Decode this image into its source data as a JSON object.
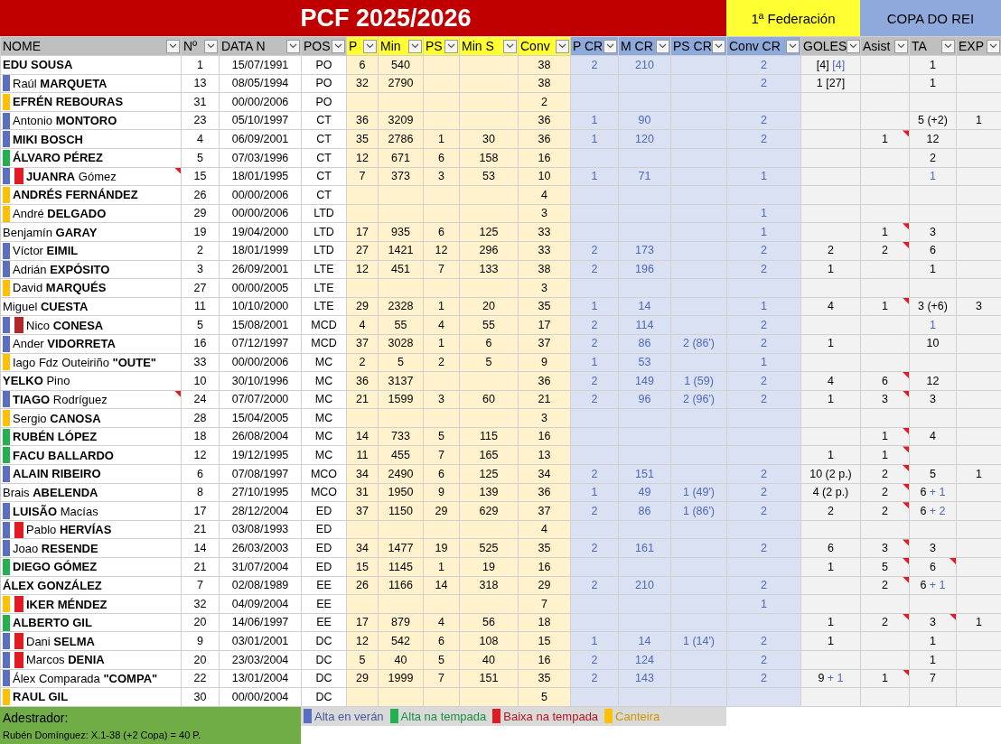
{
  "bands": [
    {
      "label": "PCF 2025/2026",
      "kind": "title"
    },
    {
      "label": "1ª Federación",
      "kind": "league"
    },
    {
      "label": "COPA DO REI",
      "kind": "cup"
    }
  ],
  "columns": [
    {
      "label": "NOME",
      "kind": "info"
    },
    {
      "label": "Nº",
      "kind": "info"
    },
    {
      "label": "DATA N",
      "kind": "info"
    },
    {
      "label": "POS",
      "kind": "info"
    },
    {
      "label": "P",
      "kind": "league"
    },
    {
      "label": "Min",
      "kind": "league"
    },
    {
      "label": "PS",
      "kind": "league"
    },
    {
      "label": "Min S",
      "kind": "league"
    },
    {
      "label": "Conv",
      "kind": "league"
    },
    {
      "label": "P CR",
      "kind": "cup"
    },
    {
      "label": "M CR",
      "kind": "cup"
    },
    {
      "label": "PS CR",
      "kind": "cup"
    },
    {
      "label": "Conv CR",
      "kind": "cup"
    },
    {
      "label": "GOLES",
      "kind": "stats"
    },
    {
      "label": "Asist",
      "kind": "stats"
    },
    {
      "label": "TA",
      "kind": "stats"
    },
    {
      "label": "EXP",
      "kind": "stats"
    }
  ],
  "rows": [
    {
      "name": "EDU SOUSA",
      "bold": true,
      "comment": false,
      "cells": [
        "1",
        "15/07/1991",
        "PO",
        "6",
        "540",
        null,
        null,
        "38",
        "2",
        "210",
        null,
        "2",
        {
          "parts": [
            {
              "text": "[4]",
              "accent": false
            },
            {
              "text": "[4]",
              "accent": true
            }
          ]
        },
        null,
        "1",
        null
      ]
    },
    {
      "name": "Raúl **MARQUETA**",
      "bold": false,
      "comment": false,
      "markers": [
        {
          "color": "#5a6ec4"
        }
      ],
      "cells": [
        "13",
        "08/05/1994",
        "PO",
        "32",
        "2790",
        null,
        null,
        "38",
        null,
        null,
        null,
        "2",
        "1 [27]",
        null,
        "1",
        null
      ]
    },
    {
      "name": "EFRÉN REBOURAS",
      "bold": true,
      "comment": false,
      "markers": [
        {
          "color": "#ffc000"
        }
      ],
      "cells": [
        "31",
        "00/00/2006",
        "PO",
        null,
        null,
        null,
        null,
        "2",
        null,
        null,
        null,
        null,
        null,
        null,
        null,
        null
      ]
    },
    {
      "name": "Antonio **MONTORO**",
      "bold": false,
      "comment": false,
      "markers": [
        {
          "color": "#5a6ec4"
        }
      ],
      "cells": [
        "23",
        "05/10/1997",
        "CT",
        "36",
        "3209",
        null,
        null,
        "36",
        "1",
        "90",
        null,
        "2",
        null,
        null,
        "5 (+2)",
        "1"
      ]
    },
    {
      "name": "MIKI BOSCH",
      "bold": true,
      "comment": false,
      "markers": [
        {
          "color": "#5a6ec4"
        }
      ],
      "cells": [
        "4",
        "06/09/2001",
        "CT",
        "35",
        "2786",
        "1",
        "30",
        "36",
        "1",
        "120",
        null,
        "2",
        null,
        {
          "text": "1",
          "comment": true
        },
        "12",
        null
      ]
    },
    {
      "name": "ÁLVARO PÉREZ",
      "bold": true,
      "comment": false,
      "markers": [
        {
          "color": "#22b14c"
        }
      ],
      "cells": [
        "5",
        "07/03/1996",
        "CT",
        "12",
        "671",
        "6",
        "158",
        "16",
        null,
        null,
        null,
        null,
        null,
        null,
        "2",
        null
      ]
    },
    {
      "name": "**JUANRA** Gómez",
      "bold": false,
      "comment": true,
      "markers": [
        {
          "color": "#5a6ec4"
        },
        {
          "color": "#e01b24"
        }
      ],
      "cells": [
        "15",
        "18/01/1995",
        "CT",
        "7",
        "373",
        "3",
        "53",
        "10",
        "1",
        "71",
        null,
        "1",
        null,
        null,
        {
          "parts": [
            {
              "text": "1",
              "accent": true
            }
          ]
        },
        null
      ]
    },
    {
      "name": "ANDRÉS FERNÁNDEZ",
      "bold": true,
      "comment": false,
      "markers": [
        {
          "color": "#ffc000"
        }
      ],
      "cells": [
        "26",
        "00/00/2006",
        "CT",
        null,
        null,
        null,
        null,
        "4",
        null,
        null,
        null,
        null,
        null,
        null,
        null,
        null
      ]
    },
    {
      "name": "André **DELGADO**",
      "bold": false,
      "comment": false,
      "markers": [
        {
          "color": "#ffc000"
        }
      ],
      "cells": [
        "29",
        "00/00/2006",
        "LTD",
        null,
        null,
        null,
        null,
        "3",
        null,
        null,
        null,
        "1",
        null,
        null,
        null,
        null
      ]
    },
    {
      "name": "Benjamín **GARAY**",
      "bold": false,
      "comment": false,
      "cells": [
        "19",
        "19/04/2000",
        "LTD",
        "17",
        "935",
        "6",
        "125",
        "33",
        null,
        null,
        null,
        "1",
        null,
        {
          "text": "1",
          "comment": true
        },
        "3",
        null
      ]
    },
    {
      "name": "Víctor **EIMIL**",
      "bold": false,
      "comment": false,
      "markers": [
        {
          "color": "#5a6ec4"
        }
      ],
      "cells": [
        "2",
        "18/01/1999",
        "LTD",
        "27",
        "1421",
        "12",
        "296",
        "33",
        "2",
        "173",
        null,
        "2",
        "2",
        {
          "text": "2",
          "comment": true
        },
        "6",
        null
      ]
    },
    {
      "name": "Adrián **EXPÓSITO**",
      "bold": false,
      "comment": false,
      "markers": [
        {
          "color": "#5a6ec4"
        }
      ],
      "cells": [
        "3",
        "26/09/2001",
        "LTE",
        "12",
        "451",
        "7",
        "133",
        "38",
        "2",
        "196",
        null,
        "2",
        "1",
        null,
        "1",
        null
      ]
    },
    {
      "name": "David **MARQUÉS**",
      "bold": false,
      "comment": false,
      "markers": [
        {
          "color": "#ffc000"
        }
      ],
      "cells": [
        "27",
        "00/00/2005",
        "LTE",
        null,
        null,
        null,
        null,
        "3",
        null,
        null,
        null,
        null,
        null,
        null,
        null,
        null
      ]
    },
    {
      "name": "Miguel **CUESTA**",
      "bold": false,
      "comment": false,
      "cells": [
        "11",
        "10/10/2000",
        "LTE",
        "29",
        "2328",
        "1",
        "20",
        "35",
        "1",
        "14",
        null,
        "1",
        "4",
        {
          "text": "1",
          "comment": true
        },
        "3 (+6)",
        "3"
      ]
    },
    {
      "name": "Nico **CONESA**",
      "bold": false,
      "comment": false,
      "markers": [
        {
          "color": "#5a6ec4"
        },
        {
          "color": "#b0262a"
        }
      ],
      "cells": [
        "5",
        "15/08/2001",
        "MCD",
        "4",
        "55",
        "4",
        "55",
        "17",
        "2",
        "114",
        null,
        "2",
        null,
        null,
        {
          "parts": [
            {
              "text": "1",
              "accent": true
            }
          ]
        },
        null
      ]
    },
    {
      "name": "Ander **VIDORRETA**",
      "bold": false,
      "comment": false,
      "markers": [
        {
          "color": "#5a6ec4"
        }
      ],
      "cells": [
        "16",
        "07/12/1997",
        "MCD",
        "37",
        "3028",
        "1",
        "6",
        "37",
        "2",
        "86",
        "2 (86')",
        "2",
        "1",
        null,
        "10",
        null
      ]
    },
    {
      "name": "Iago Fdz Outeiriño **\"OUTE\"**",
      "bold": false,
      "comment": false,
      "markers": [
        {
          "color": "#ffc000"
        }
      ],
      "cells": [
        "33",
        "00/00/2006",
        "MC",
        "2",
        "5",
        "2",
        "5",
        "9",
        "1",
        "53",
        null,
        "1",
        null,
        null,
        null,
        null
      ]
    },
    {
      "name": "**YELKO** Pino",
      "bold": false,
      "comment": false,
      "cells": [
        "10",
        "30/10/1996",
        "MC",
        "36",
        "3137",
        null,
        null,
        "36",
        "2",
        "149",
        "1 (59)",
        "2",
        "4",
        {
          "text": "6",
          "comment": true
        },
        "12",
        null
      ]
    },
    {
      "name": "**TIAGO** Rodríguez",
      "bold": false,
      "comment": true,
      "markers": [
        {
          "color": "#5a6ec4"
        }
      ],
      "cells": [
        "24",
        "07/07/2000",
        "MC",
        "21",
        "1599",
        "3",
        "60",
        "21",
        "2",
        "96",
        "2 (96')",
        "2",
        "1",
        {
          "text": "3",
          "comment": true
        },
        "3",
        null
      ]
    },
    {
      "name": "Sergio  **CANOSA**",
      "bold": false,
      "comment": false,
      "markers": [
        {
          "color": "#ffc000"
        }
      ],
      "cells": [
        "28",
        "15/04/2005",
        "MC",
        null,
        null,
        null,
        null,
        "3",
        null,
        null,
        null,
        null,
        null,
        null,
        null,
        null
      ]
    },
    {
      "name": "RUBÉN LÓPEZ",
      "bold": true,
      "comment": false,
      "markers": [
        {
          "color": "#22b14c"
        }
      ],
      "cells": [
        "18",
        "26/08/2004",
        "MC",
        "14",
        "733",
        "5",
        "115",
        "16",
        null,
        null,
        null,
        null,
        null,
        {
          "text": "1",
          "comment": true
        },
        "4",
        null
      ]
    },
    {
      "name": "FACU BALLARDO",
      "bold": true,
      "comment": false,
      "markers": [
        {
          "color": "#22b14c"
        }
      ],
      "cells": [
        "12",
        "19/12/1995",
        "MC",
        "11",
        "455",
        "7",
        "165",
        "13",
        null,
        null,
        null,
        null,
        "1",
        {
          "text": "1",
          "comment": true
        },
        null,
        null
      ]
    },
    {
      "name": "ALAIN RIBEIRO",
      "bold": true,
      "comment": false,
      "markers": [
        {
          "color": "#5a6ec4"
        }
      ],
      "cells": [
        "6",
        "07/08/1997",
        "MCO",
        "34",
        "2490",
        "6",
        "125",
        "34",
        "2",
        "151",
        null,
        "2",
        "10 (2 p.)",
        {
          "text": "2",
          "comment": true
        },
        "5",
        "1"
      ]
    },
    {
      "name": "Brais **ABELENDA**",
      "bold": false,
      "comment": false,
      "cells": [
        "8",
        "27/10/1995",
        "MCO",
        "31",
        "1950",
        "9",
        "139",
        "36",
        "1",
        "49",
        "1 (49')",
        "2",
        "4 (2 p.)",
        {
          "text": "2",
          "comment": true
        },
        {
          "parts": [
            {
              "text": "6",
              "accent": false
            },
            {
              "text": "+ 1",
              "accent": true
            }
          ]
        },
        null
      ]
    },
    {
      "name": "**LUISÃO** Macías",
      "bold": false,
      "comment": false,
      "markers": [
        {
          "color": "#5a6ec4"
        }
      ],
      "cells": [
        "17",
        "28/12/2004",
        "ED",
        "37",
        "1150",
        "29",
        "629",
        "37",
        "2",
        "86",
        "1 (86')",
        "2",
        "2",
        {
          "text": "2",
          "comment": true
        },
        {
          "parts": [
            {
              "text": "6",
              "accent": false
            },
            {
              "text": "+ 2",
              "accent": true
            }
          ]
        },
        null
      ]
    },
    {
      "name": "Pablo **HERVÍAS**",
      "bold": false,
      "comment": false,
      "markers": [
        {
          "color": "#5a6ec4"
        },
        {
          "color": "#e01b24"
        }
      ],
      "cells": [
        "21",
        "03/08/1993",
        "ED",
        null,
        null,
        null,
        null,
        "4",
        null,
        null,
        null,
        null,
        null,
        null,
        null,
        null
      ]
    },
    {
      "name": "Joao **RESENDE**",
      "bold": false,
      "comment": false,
      "markers": [
        {
          "color": "#5a6ec4"
        }
      ],
      "cells": [
        "14",
        "26/03/2003",
        "ED",
        "34",
        "1477",
        "19",
        "525",
        "35",
        "2",
        "161",
        null,
        "2",
        "6",
        {
          "text": "3",
          "comment": true
        },
        "3",
        null
      ]
    },
    {
      "name": "DIEGO GÓMEZ",
      "bold": true,
      "comment": false,
      "markers": [
        {
          "color": "#22b14c"
        }
      ],
      "cells": [
        "21",
        "31/07/2004",
        "ED",
        "15",
        "1145",
        "1",
        "19",
        "16",
        null,
        null,
        null,
        null,
        "1",
        {
          "text": "5",
          "comment": true
        },
        {
          "text": "6",
          "comment": true
        },
        null
      ]
    },
    {
      "name": "ÁLEX GONZÁLEZ",
      "bold": true,
      "comment": false,
      "cells": [
        "7",
        "02/08/1989",
        "EE",
        "26",
        "1166",
        "14",
        "318",
        "29",
        "2",
        "210",
        null,
        "2",
        null,
        {
          "text": "2",
          "comment": true
        },
        {
          "parts": [
            {
              "text": "6",
              "accent": false
            },
            {
              "text": "+ 1",
              "accent": true
            }
          ]
        },
        null
      ]
    },
    {
      "name": "IKER MÉNDEZ",
      "bold": true,
      "comment": false,
      "markers": [
        {
          "color": "#ffc000"
        },
        {
          "color": "#e01b24"
        }
      ],
      "cells": [
        "32",
        "04/09/2004",
        "EE",
        null,
        null,
        null,
        null,
        "7",
        null,
        null,
        null,
        "1",
        null,
        null,
        null,
        null
      ]
    },
    {
      "name": "ALBERTO GIL",
      "bold": true,
      "comment": false,
      "markers": [
        {
          "color": "#22b14c"
        }
      ],
      "cells": [
        "20",
        "14/06/1997",
        "EE",
        "17",
        "879",
        "4",
        "56",
        "18",
        null,
        null,
        null,
        null,
        "1",
        {
          "text": "2",
          "comment": true
        },
        {
          "text": "3",
          "comment": true
        },
        "1"
      ]
    },
    {
      "name": "Dani **SELMA**",
      "bold": false,
      "comment": false,
      "markers": [
        {
          "color": "#5a6ec4"
        },
        {
          "color": "#e01b24"
        }
      ],
      "cells": [
        "9",
        "03/01/2001",
        "DC",
        "12",
        "542",
        "6",
        "108",
        "15",
        "1",
        "14",
        "1 (14')",
        "2",
        "1",
        null,
        "1",
        null
      ]
    },
    {
      "name": "Marcos **DENIA**",
      "bold": false,
      "comment": false,
      "markers": [
        {
          "color": "#5a6ec4"
        },
        {
          "color": "#e01b24"
        }
      ],
      "cells": [
        "20",
        "23/03/2004",
        "DC",
        "5",
        "40",
        "5",
        "40",
        "16",
        "2",
        "124",
        null,
        "2",
        null,
        null,
        "1",
        null
      ]
    },
    {
      "name": "Álex Comparada **\"COMPA\"**",
      "bold": false,
      "comment": false,
      "markers": [
        {
          "color": "#5a6ec4"
        }
      ],
      "cells": [
        "22",
        "13/01/2004",
        "DC",
        "29",
        "1999",
        "7",
        "151",
        "35",
        "2",
        "143",
        null,
        "2",
        {
          "parts": [
            {
              "text": "9",
              "accent": false
            },
            {
              "text": "+ 1",
              "accent": true
            }
          ]
        },
        {
          "text": "1",
          "comment": true
        },
        "7",
        null
      ]
    },
    {
      "name": "RAUL GIL",
      "bold": true,
      "comment": false,
      "markers": [
        {
          "color": "#ffc000"
        }
      ],
      "cells": [
        "30",
        "00/00/2004",
        "DC",
        null,
        null,
        null,
        null,
        "5",
        null,
        null,
        null,
        null,
        null,
        null,
        null,
        null
      ]
    }
  ],
  "coach": {
    "title": "Adestrador:",
    "note": "Rubén Domínguez: X.1-38 (+2 Copa) = 40 P."
  },
  "legend": [
    {
      "label": "Alta en verán",
      "color": "#5a6ec4"
    },
    {
      "label": "Alta na tempada",
      "color": "#22b14c"
    },
    {
      "label": "Baixa na tempada",
      "color": "#e01b24"
    },
    {
      "label": "Canteira",
      "color": "#ffc000"
    }
  ]
}
